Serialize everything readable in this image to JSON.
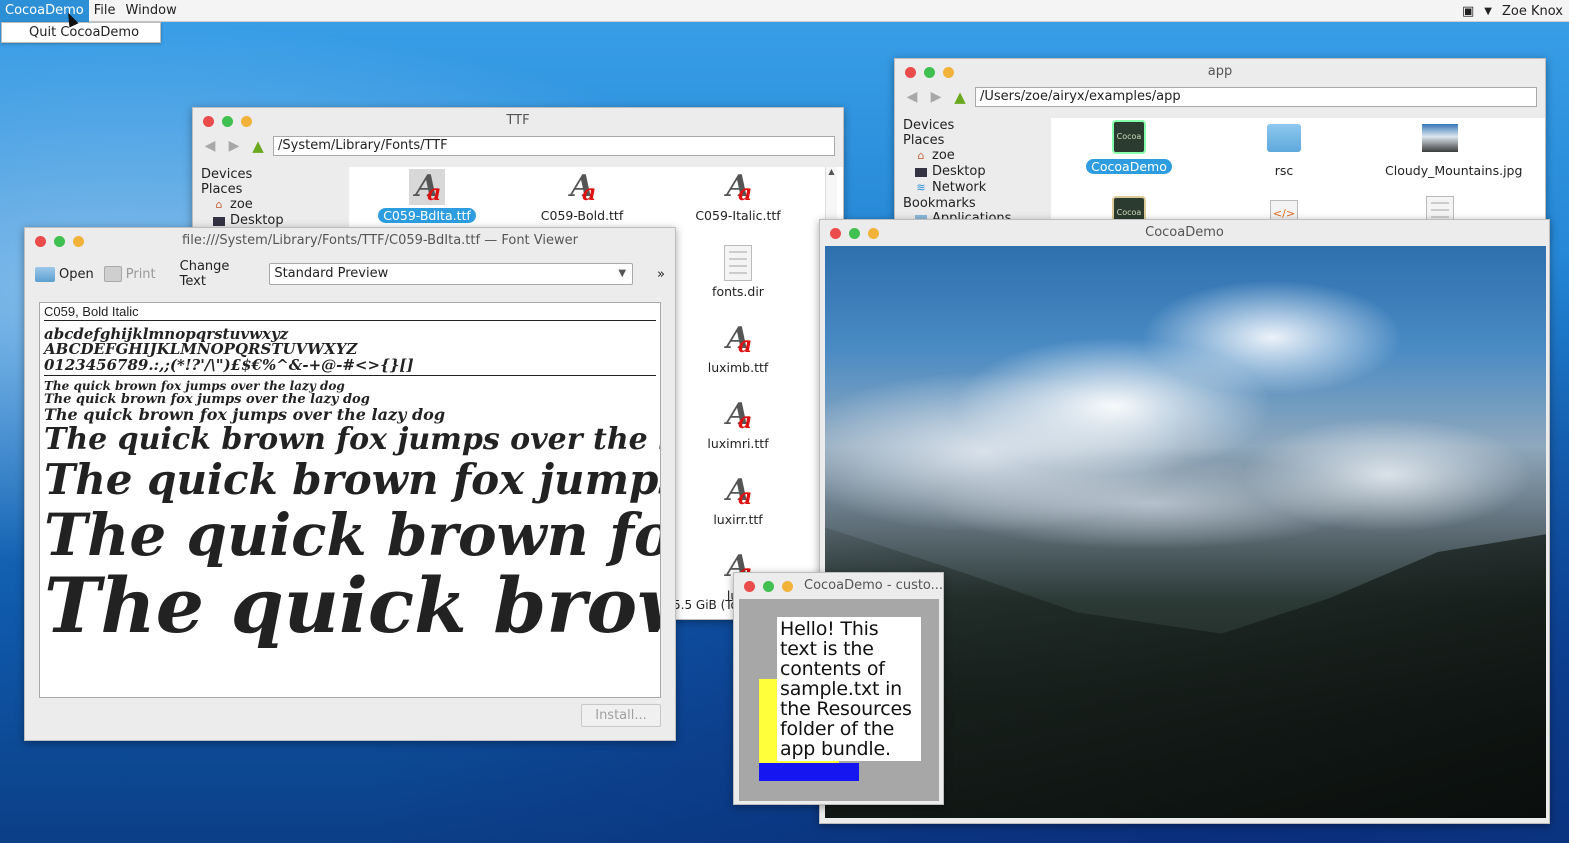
{
  "menubar": {
    "items": [
      "CocoaDemo",
      "File",
      "Window"
    ],
    "active_item": "CocoaDemo",
    "dropdown_item": "Quit CocoaDemo",
    "user": "Zoe Knox"
  },
  "ttf_window": {
    "title": "TTF",
    "path": "/System/Library/Fonts/TTF",
    "sidebar": {
      "devices": "Devices",
      "places": "Places",
      "items": [
        "zoe",
        "Desktop"
      ]
    },
    "files": [
      "C059-BdIta.ttf",
      "C059-Bold.ttf",
      "C059-Italic.ttf",
      "fonts.dir",
      "luximb.ttf",
      "luximri.ttf",
      "luxirr.ttf",
      "luxi"
    ],
    "selected_file": "C059-BdIta.ttf",
    "status": "5.5 GiB (To"
  },
  "app_window": {
    "title": "app",
    "path": "/Users/zoe/airyx/examples/app",
    "sidebar": {
      "devices": "Devices",
      "places": "Places",
      "items": [
        "zoe",
        "Desktop",
        "Network"
      ],
      "bookmarks": "Bookmarks",
      "bookmark_items": [
        "Applications"
      ]
    },
    "files": [
      "CocoaDemo",
      "rsc",
      "Cloudy_Mountains.jpg"
    ],
    "selected_file": "CocoaDemo"
  },
  "font_viewer": {
    "title": "file:///System/Library/Fonts/TTF/C059-BdIta.ttf — Font Viewer",
    "toolbar": {
      "open": "Open",
      "print": "Print",
      "change_text": "Change Text",
      "preview_mode": "Standard Preview",
      "overflow": "»"
    },
    "font_name": "C059, Bold Italic",
    "lowercase": "abcdefghijklmnopqrstuvwxyz",
    "uppercase": "ABCDEFGHIJKLMNOPQRSTUVWXYZ",
    "digits": "0123456789.:,;(*!?'/\\\")£$€%^&-+@-#<>{}[]",
    "pangram": "The quick brown fox jumps over the lazy dog",
    "install_label": "Install..."
  },
  "cocoademo_window": {
    "title": "CocoaDemo"
  },
  "custom_window": {
    "title": "CocoaDemo - custo...",
    "text": "Hello! This text is the contents of sample.txt in the Resources folder of the app bundle."
  },
  "colors": {
    "accent": "#2d8fd5",
    "yellow": "#ffff3c",
    "blue": "#1616f0"
  }
}
